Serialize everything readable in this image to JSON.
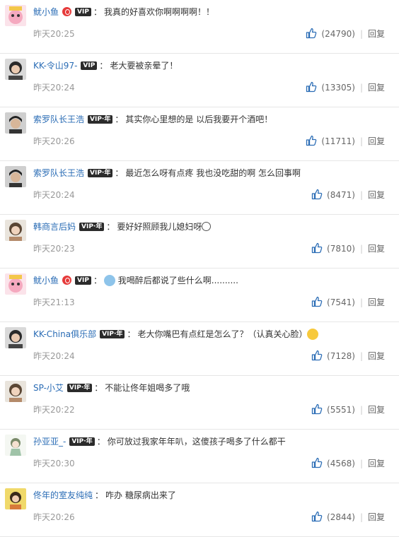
{
  "comments": [
    {
      "user": "鱿小鱼",
      "badge": "VIP",
      "has_weibo_icon": true,
      "text": "我真的好喜欢你啊啊啊啊！！",
      "pre_emoji": "",
      "post_emoji": "",
      "time": "昨天20:25",
      "likes": "(24790)",
      "reply": "回复",
      "avatar": "avatar-pink-cartoon"
    },
    {
      "user": "KK-令山97-",
      "badge": "VIP",
      "has_weibo_icon": false,
      "text": "老大要被亲晕了！",
      "pre_emoji": "",
      "post_emoji": "",
      "time": "昨天20:24",
      "likes": "(13305)",
      "reply": "回复",
      "avatar": "avatar-girl-dark"
    },
    {
      "user": "索罗队长王浩",
      "badge": "VIP·年",
      "has_weibo_icon": false,
      "text": "其实你心里想的是 以后我要开个酒吧！",
      "pre_emoji": "",
      "post_emoji": "",
      "time": "昨天20:26",
      "likes": "(11711)",
      "reply": "回复",
      "avatar": "avatar-boy-dark"
    },
    {
      "user": "索罗队长王浩",
      "badge": "VIP·年",
      "has_weibo_icon": false,
      "text": "最近怎么呀有点疼 我也没吃甜的啊 怎么回事啊",
      "pre_emoji": "",
      "post_emoji": "",
      "time": "昨天20:24",
      "likes": "(8471)",
      "reply": "回复",
      "avatar": "avatar-boy-dark"
    },
    {
      "user": "韩商言后妈",
      "badge": "VIP·年",
      "has_weibo_icon": false,
      "text": "要好好照顾我儿媳妇呀",
      "pre_emoji": "",
      "post_emoji": "smile-emoji",
      "time": "昨天20:23",
      "likes": "(7810)",
      "reply": "回复",
      "avatar": "avatar-girl-light"
    },
    {
      "user": "鱿小鱼",
      "badge": "VIP",
      "has_weibo_icon": true,
      "text": "我喝醉后都说了些什么啊..........",
      "pre_emoji": "shock-emoji",
      "post_emoji": "",
      "time": "昨天21:13",
      "likes": "(7541)",
      "reply": "回复",
      "avatar": "avatar-pink-cartoon"
    },
    {
      "user": "KK-China俱乐部",
      "badge": "VIP·年",
      "has_weibo_icon": false,
      "text": "老大你嘴巴有点红是怎么了？（认真关心脸）",
      "pre_emoji": "",
      "post_emoji": "blush-emoji",
      "time": "昨天20:24",
      "likes": "(7128)",
      "reply": "回复",
      "avatar": "avatar-girl-dark"
    },
    {
      "user": "SP-小艾",
      "badge": "VIP·年",
      "has_weibo_icon": false,
      "text": "不能让佟年姐喝多了哦",
      "pre_emoji": "",
      "post_emoji": "",
      "time": "昨天20:22",
      "likes": "(5551)",
      "reply": "回复",
      "avatar": "avatar-girl-light"
    },
    {
      "user": "孙亚亚_-",
      "badge": "VIP·年",
      "has_weibo_icon": false,
      "text": "你可放过我家年年叭，这傻孩子喝多了什么都干",
      "pre_emoji": "",
      "post_emoji": "",
      "time": "昨天20:30",
      "likes": "(4568)",
      "reply": "回复",
      "avatar": "avatar-anime-girl"
    },
    {
      "user": "佟年的室友纯纯",
      "badge": "",
      "has_weibo_icon": false,
      "text": "咋办 糖尿病出来了",
      "pre_emoji": "",
      "post_emoji": "",
      "time": "昨天20:26",
      "likes": "(2844)",
      "reply": "回复",
      "avatar": "avatar-girl-yellow"
    }
  ],
  "colors": {
    "username": "#2a6cb5",
    "like_icon": "#2a6cb5",
    "meta": "#999999"
  }
}
